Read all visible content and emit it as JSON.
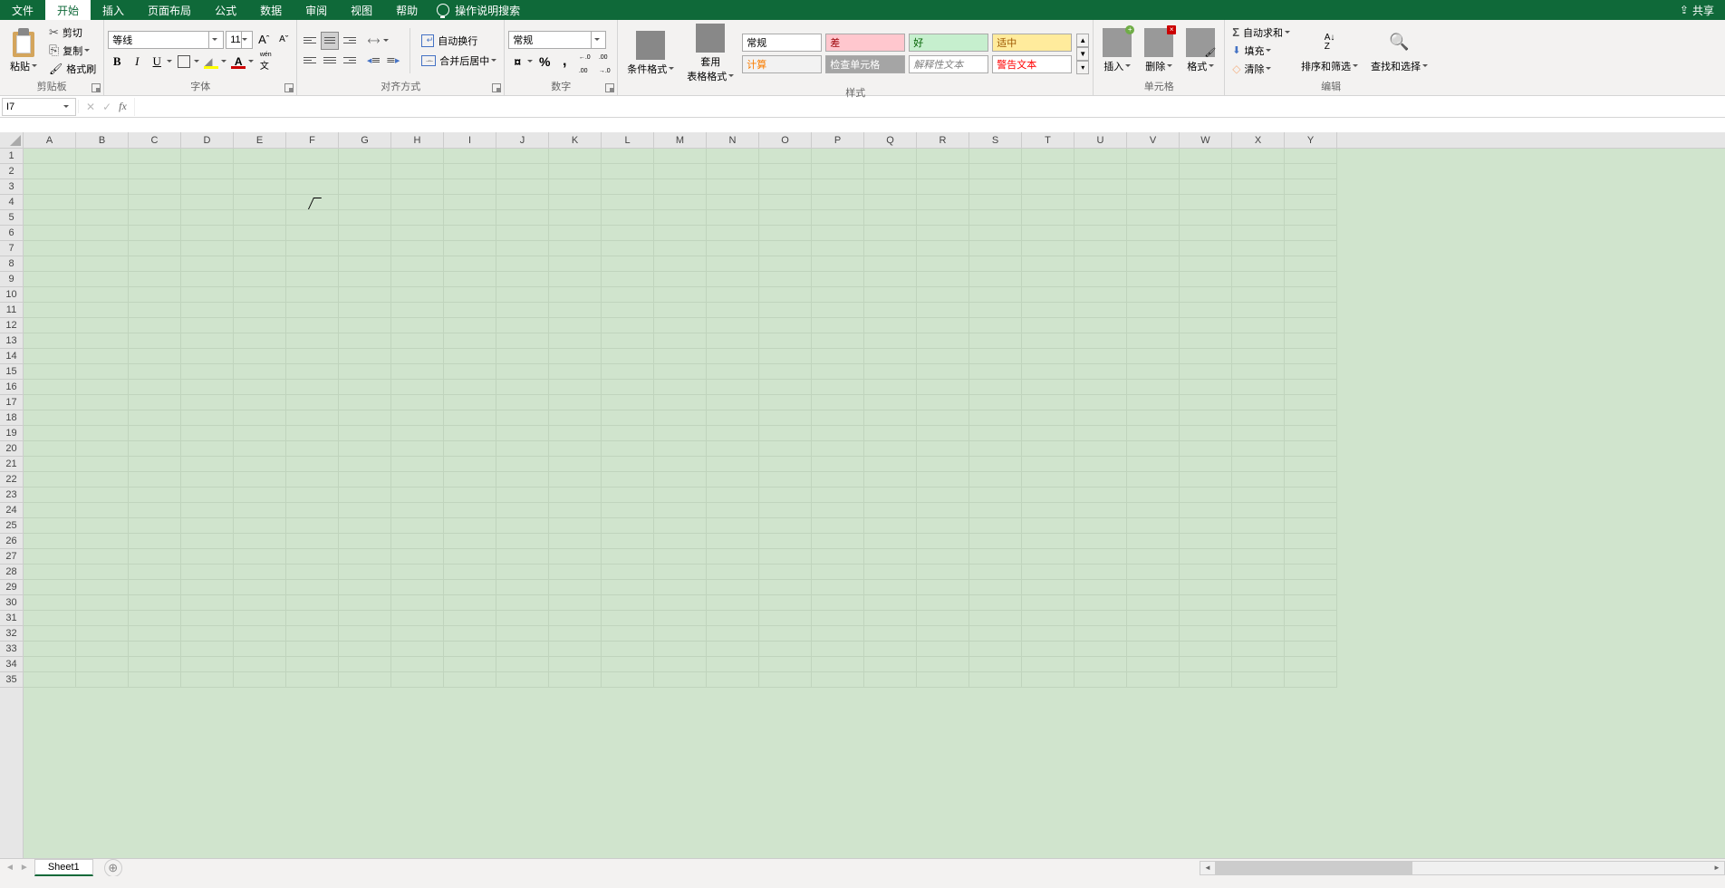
{
  "tabs": [
    "文件",
    "开始",
    "插入",
    "页面布局",
    "公式",
    "数据",
    "审阅",
    "视图",
    "帮助"
  ],
  "active_tab_index": 1,
  "tell_me": "操作说明搜索",
  "share": "共享",
  "clipboard": {
    "paste": "粘贴",
    "cut": "剪切",
    "copy": "复制",
    "painter": "格式刷",
    "label": "剪贴板"
  },
  "font": {
    "name": "等线",
    "size": "11",
    "label": "字体"
  },
  "alignment": {
    "wrap": "自动换行",
    "merge": "合并后居中",
    "label": "对齐方式"
  },
  "number": {
    "format": "常规",
    "label": "数字"
  },
  "styles": {
    "cond": "条件格式",
    "table": "套用\n表格格式",
    "cells": [
      {
        "t": "常规",
        "bg": "#ffffff",
        "fg": "#000"
      },
      {
        "t": "差",
        "bg": "#ffc7ce",
        "fg": "#9c0006"
      },
      {
        "t": "好",
        "bg": "#c6efce",
        "fg": "#006100"
      },
      {
        "t": "适中",
        "bg": "#ffeb9c",
        "fg": "#9c5700"
      },
      {
        "t": "计算",
        "bg": "#f2f2f2",
        "fg": "#fa7d00"
      },
      {
        "t": "检查单元格",
        "bg": "#a5a5a5",
        "fg": "#ffffff"
      },
      {
        "t": "解释性文本",
        "bg": "#ffffff",
        "fg": "#7f7f7f",
        "italic": true
      },
      {
        "t": "警告文本",
        "bg": "#ffffff",
        "fg": "#ff0000"
      }
    ],
    "label": "样式"
  },
  "cells_group": {
    "insert": "插入",
    "delete": "删除",
    "format": "格式",
    "label": "单元格"
  },
  "editing": {
    "sum": "自动求和",
    "fill": "填充",
    "clear": "清除",
    "sort": "排序和筛选",
    "find": "查找和选择",
    "label": "编辑"
  },
  "name_box": "I7",
  "sheet": "Sheet1",
  "columns": [
    "A",
    "B",
    "C",
    "D",
    "E",
    "F",
    "G",
    "H",
    "I",
    "J",
    "K",
    "L",
    "M",
    "N",
    "O",
    "P",
    "Q",
    "R",
    "S",
    "T",
    "U",
    "V",
    "W",
    "X",
    "Y"
  ],
  "row_count": 35
}
